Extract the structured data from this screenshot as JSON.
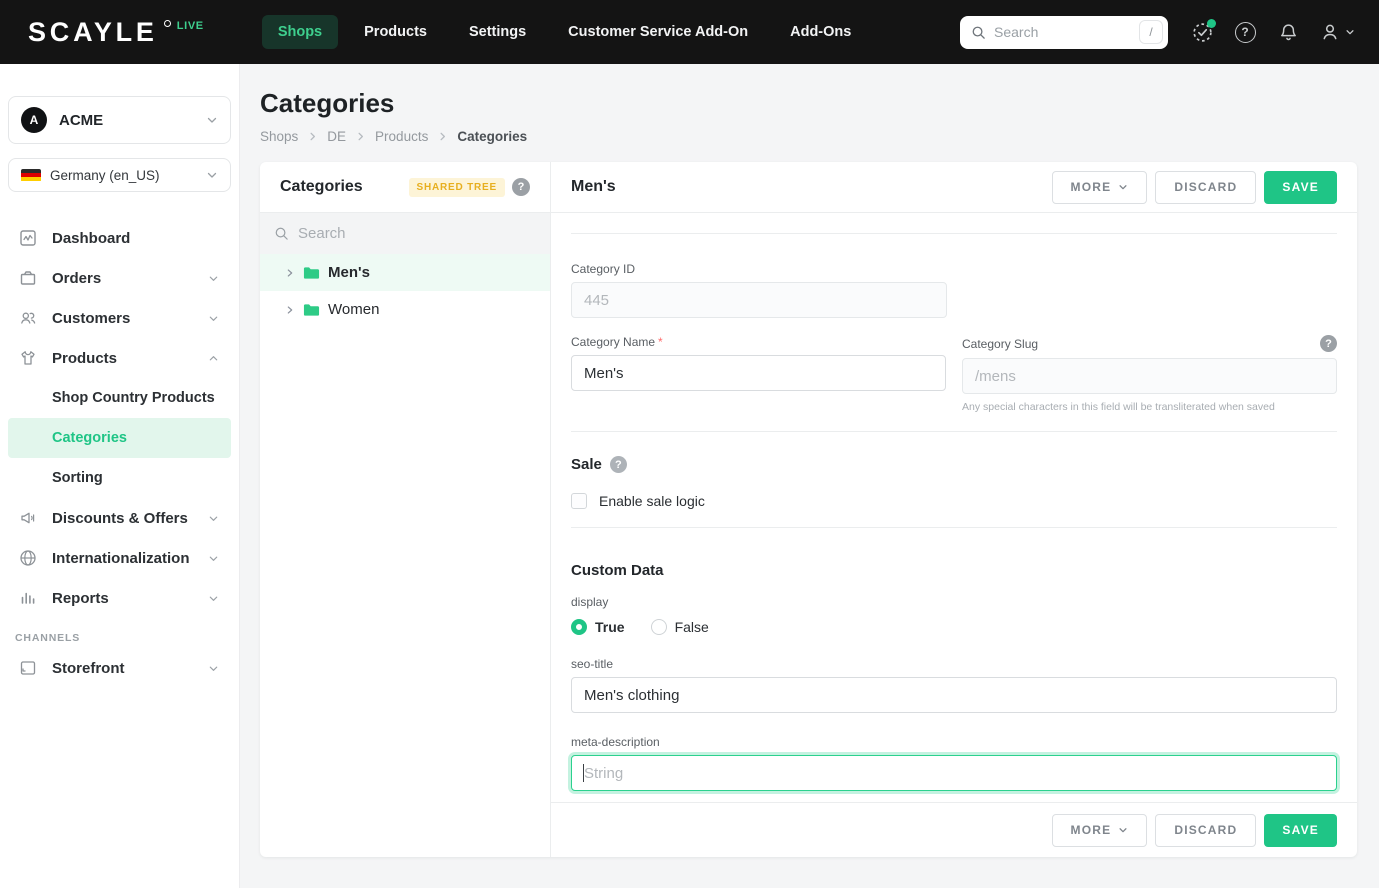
{
  "colors": {
    "accent": "#1fc586",
    "accent-nav-text": "#3ecf8e",
    "accent-nav-bg": "#17352a",
    "accent-light-bg": "#e2f6ec",
    "row-selected-bg": "#eefaf4",
    "badge-yellow-text": "#e7af1f",
    "badge-yellow-bg": "#fdf4d7",
    "topbar-bg": "#141414",
    "danger": "#ff6b6b"
  },
  "topbar": {
    "logo": "SCAYLE",
    "logo_badge": "LIVE",
    "nav": [
      "Shops",
      "Products",
      "Settings",
      "Customer Service Add-On",
      "Add-Ons"
    ],
    "search_placeholder": "Search",
    "search_shortcut": "/"
  },
  "icons": {
    "question": "?"
  },
  "sidebar": {
    "org_name": "ACME",
    "org_initial": "A",
    "locale": "Germany (en_US)",
    "dashboard": "Dashboard",
    "orders": "Orders",
    "customers": "Customers",
    "products": "Products",
    "shop_country_products": "Shop Country Products",
    "categories": "Categories",
    "sorting": "Sorting",
    "discounts": "Discounts & Offers",
    "internationalization": "Internationalization",
    "reports": "Reports",
    "channels_label": "CHANNELS",
    "storefront": "Storefront"
  },
  "page": {
    "title": "Categories",
    "breadcrumb": [
      "Shops",
      "DE",
      "Products",
      "Categories"
    ]
  },
  "tree": {
    "header": "Categories",
    "badge": "SHARED TREE",
    "search_placeholder": "Search",
    "items": [
      {
        "label": "Men's",
        "selected": true
      },
      {
        "label": "Women",
        "selected": false
      }
    ]
  },
  "detail": {
    "title": "Men's",
    "actions": {
      "more": "MORE",
      "discard": "DISCARD",
      "save": "SAVE"
    },
    "fields": {
      "category_id": {
        "label": "Category ID",
        "value": "445"
      },
      "category_name": {
        "label": "Category Name",
        "value": "Men's",
        "required": "*"
      },
      "category_slug": {
        "label": "Category Slug",
        "placeholder": "/mens",
        "helper": "Any special characters in this field will be transliterated when saved"
      }
    },
    "sale": {
      "title": "Sale",
      "checkbox_label": "Enable sale logic",
      "checked": false
    },
    "custom_data": {
      "title": "Custom Data",
      "display": {
        "label": "display",
        "option_true": "True",
        "option_false": "False",
        "selected": "True"
      },
      "seo_title": {
        "label": "seo-title",
        "value": "Men's clothing"
      },
      "meta_description": {
        "label": "meta-description",
        "placeholder": "String"
      }
    }
  }
}
